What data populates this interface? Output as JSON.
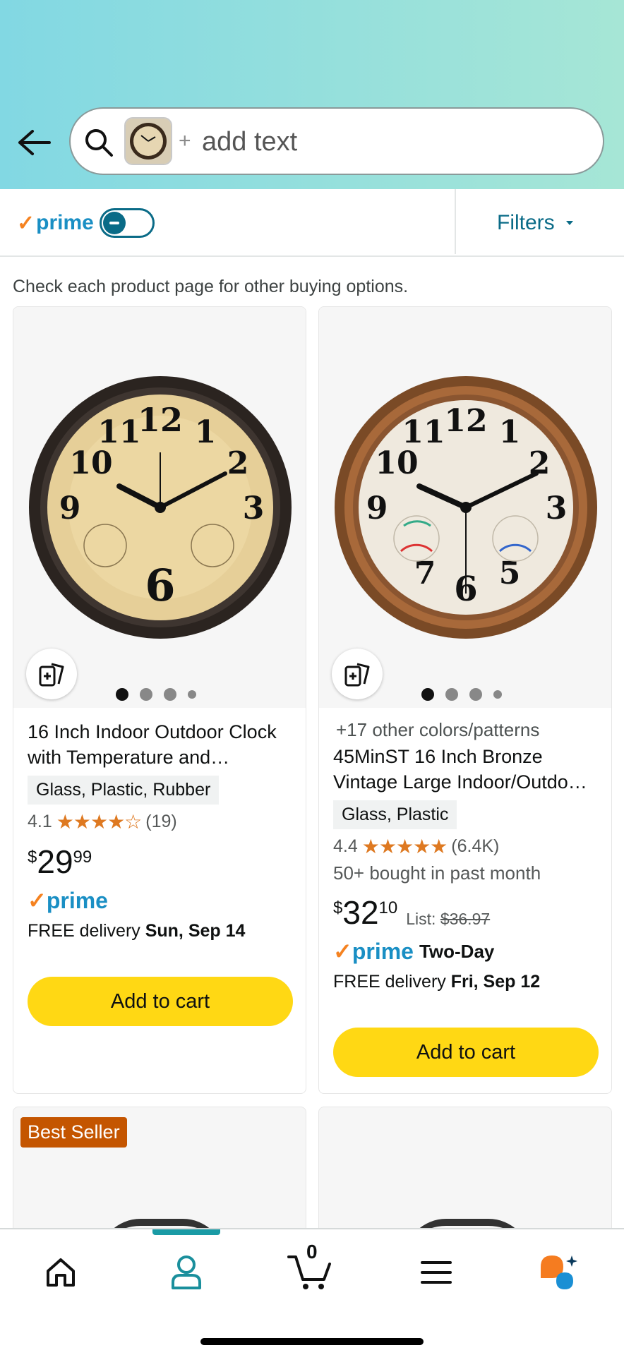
{
  "search": {
    "placeholder": "add text",
    "plus": "+"
  },
  "filterbar": {
    "prime_label": "prime",
    "prime_check": "✓",
    "filters_label": "Filters"
  },
  "notice": "Check each product page for other buying options.",
  "products": [
    {
      "subline": "",
      "title": "16 Inch Indoor Outdoor Clock with Temperature and…",
      "material": "Glass, Plastic, Rubber",
      "rating": "4.1",
      "stars": "★★★★☆",
      "reviews": "(19)",
      "bought": "",
      "price_symbol": "$",
      "price_whole": "29",
      "price_fraction": "99",
      "list_label": "",
      "list_price": "",
      "prime": "prime",
      "shipping_speed": "",
      "delivery_prefix": "FREE delivery ",
      "delivery_date": "Sun, Sep 14",
      "cart_label": "Add to cart"
    },
    {
      "subline": "+17 other colors/patterns",
      "title": "45MinST 16 Inch Bronze Vintage Large Indoor/Outdo…",
      "material": "Glass, Plastic",
      "rating": "4.4",
      "stars": "★★★★★",
      "reviews": "(6.4K)",
      "bought": "50+ bought in past month",
      "price_symbol": "$",
      "price_whole": "32",
      "price_fraction": "10",
      "list_label": "List: ",
      "list_price": "$36.97",
      "prime": "prime",
      "shipping_speed": "Two-Day",
      "delivery_prefix": "FREE delivery ",
      "delivery_date": "Fri, Sep 12",
      "cart_label": "Add to cart"
    }
  ],
  "row2": {
    "badge": "Best Seller"
  },
  "nav": {
    "cart_count": "0"
  },
  "colors": {
    "accent": "#0a6b87",
    "prime_blue": "#1a8fc4",
    "cart_yellow": "#ffd814",
    "badge": "#c45500",
    "star": "#de7921"
  }
}
